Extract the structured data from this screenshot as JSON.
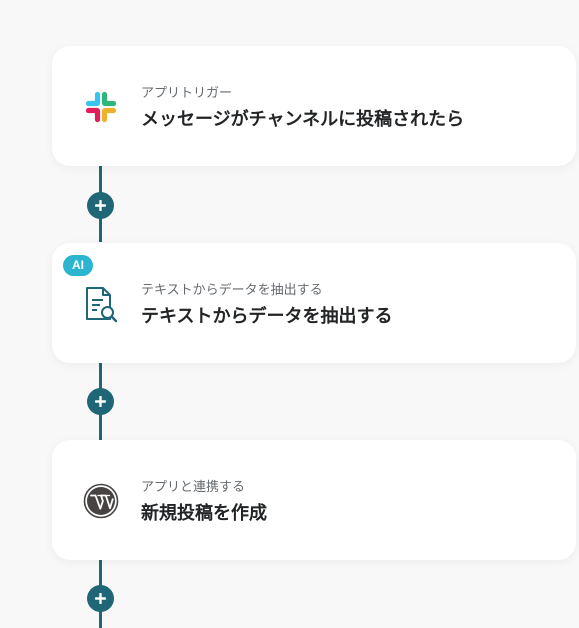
{
  "flow": {
    "steps": [
      {
        "subtitle": "アプリトリガー",
        "title": "メッセージがチャンネルに投稿されたら",
        "icon": "slack-icon"
      },
      {
        "badge": "AI",
        "subtitle": "テキストからデータを抽出する",
        "title": "テキストからデータを抽出する",
        "icon": "document-search-icon"
      },
      {
        "subtitle": "アプリと連携する",
        "title": "新規投稿を作成",
        "icon": "wordpress-icon"
      }
    ],
    "add_button_icon": "plus-icon"
  },
  "colors": {
    "connector": "#1f6677",
    "ai_badge": "#2bb5d0",
    "card_background": "#ffffff",
    "page_background": "#f8f8f9"
  }
}
